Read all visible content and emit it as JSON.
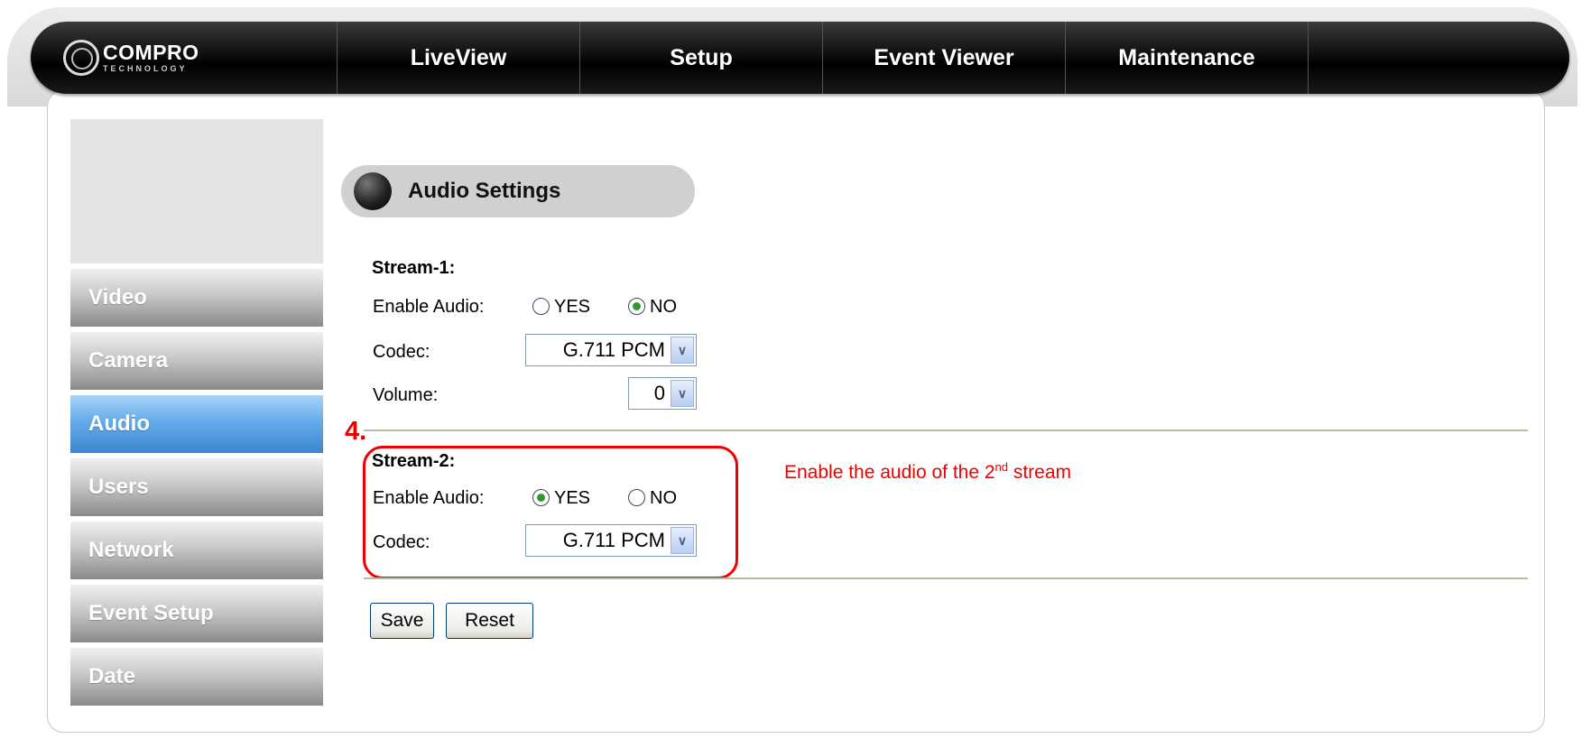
{
  "brand": {
    "name": "COMPRO",
    "tagline": "TECHNOLOGY"
  },
  "nav": [
    {
      "label": "LiveView"
    },
    {
      "label": "Setup"
    },
    {
      "label": "Event Viewer"
    },
    {
      "label": "Maintenance"
    }
  ],
  "sidebar": {
    "items": [
      {
        "label": "Video",
        "active": false
      },
      {
        "label": "Camera",
        "active": false
      },
      {
        "label": "Audio",
        "active": true
      },
      {
        "label": "Users",
        "active": false
      },
      {
        "label": "Network",
        "active": false
      },
      {
        "label": "Event Setup",
        "active": false
      },
      {
        "label": "Date",
        "active": false
      }
    ]
  },
  "section_title": "Audio Settings",
  "stream1": {
    "heading": "Stream-1:",
    "enable_label": "Enable Audio:",
    "yes_label": "YES",
    "no_label": "NO",
    "enabled": false,
    "codec_label": "Codec:",
    "codec_value": "G.711 PCM",
    "volume_label": "Volume:",
    "volume_value": "0"
  },
  "stream2": {
    "heading": "Stream-2:",
    "enable_label": "Enable Audio:",
    "yes_label": "YES",
    "no_label": "NO",
    "enabled": true,
    "codec_label": "Codec:",
    "codec_value": "G.711 PCM"
  },
  "annotation": {
    "step": "4.",
    "text_before": "Enable the audio of the 2",
    "text_sup": "nd",
    "text_after": " stream",
    "color": "#e00000"
  },
  "buttons": {
    "save": "Save",
    "reset": "Reset"
  }
}
